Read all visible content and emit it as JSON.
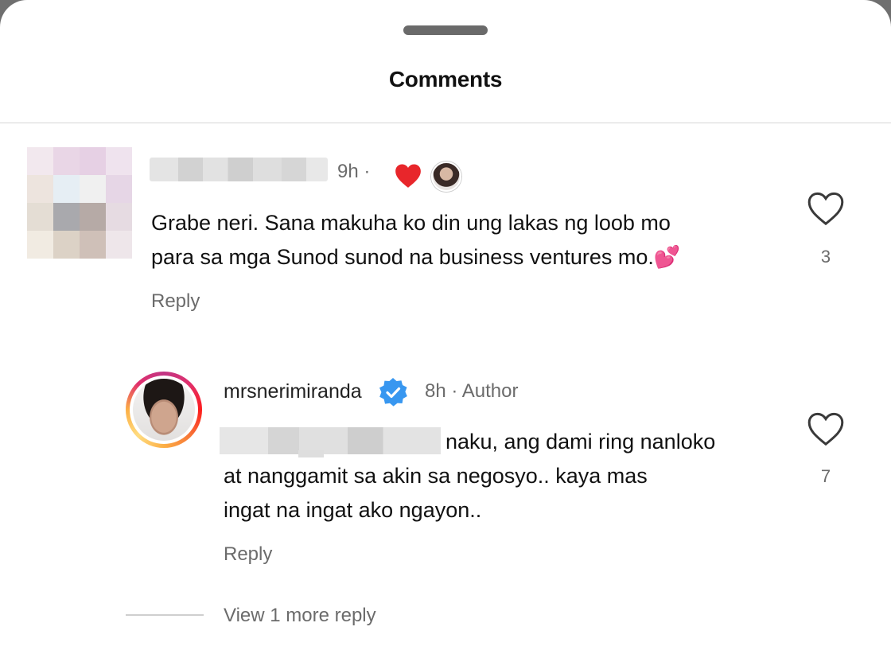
{
  "sheet": {
    "title": "Comments"
  },
  "comments": [
    {
      "time": "9h",
      "separator": "·",
      "text_line1": "Grabe neri. Sana makuha ko din ung lakas ng loob mo",
      "text_line2": "para sa mga Sunod sunod na business ventures mo.💕",
      "reply_label": "Reply",
      "like_count": "3",
      "liked_by_author": true
    },
    {
      "username": "mrsnerimiranda",
      "verified": true,
      "time": "8h",
      "separator": "·",
      "badge": "Author",
      "text_line1": "naku, ang dami ring nanloko",
      "text_line2": "at nanggamit sa akin sa negosyo.. kaya mas",
      "text_line3": "ingat na ingat ako ngayon..",
      "reply_label": "Reply",
      "like_count": "7"
    }
  ],
  "view_more": "View 1 more reply",
  "colors": {
    "heart_red": "#e8262b",
    "verified_blue": "#3897f0",
    "muted_text": "#6b6b6b"
  },
  "icons": [
    "heart-filled-icon",
    "heart-outline-icon",
    "verified-badge-icon"
  ]
}
